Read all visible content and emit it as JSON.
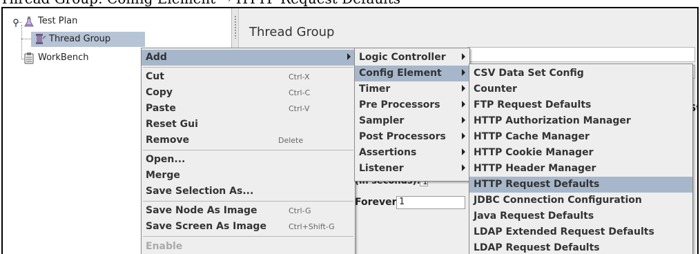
{
  "caption": "Thread Group: Config Element → HTTP Request Defaults",
  "tree": {
    "nodes": [
      {
        "label": "Test Plan",
        "icon": "flask-icon"
      },
      {
        "label": "Thread Group",
        "icon": "spool-icon"
      },
      {
        "label": "WorkBench",
        "icon": "clipboard-icon"
      }
    ]
  },
  "panel": {
    "title": "Thread Group",
    "loop_forever_label": "Forever",
    "loop_count_value": "1",
    "ramp_label_partial": "(in seconds):",
    "ramp_value": "1",
    "side_fragment": "St"
  },
  "context_menu": {
    "items": [
      {
        "label": "Add",
        "shortcut": "",
        "submenu": true,
        "selected": true
      },
      {
        "label": "Cut",
        "shortcut": "Ctrl-X"
      },
      {
        "label": "Copy",
        "shortcut": "Ctrl-C"
      },
      {
        "label": "Paste",
        "shortcut": "Ctrl-V"
      },
      {
        "label": "Reset Gui",
        "shortcut": ""
      },
      {
        "label": "Remove",
        "shortcut": "Delete"
      },
      {
        "label": "Open...",
        "shortcut": ""
      },
      {
        "label": "Merge",
        "shortcut": ""
      },
      {
        "label": "Save Selection As...",
        "shortcut": ""
      },
      {
        "label": "Save Node As Image",
        "shortcut": "Ctrl-G"
      },
      {
        "label": "Save Screen As Image",
        "shortcut": "Ctrl+Shift-G"
      },
      {
        "label": "Enable",
        "shortcut": "",
        "disabled": true
      }
    ]
  },
  "add_submenu": {
    "items": [
      {
        "label": "Logic Controller"
      },
      {
        "label": "Config Element",
        "selected": true
      },
      {
        "label": "Timer"
      },
      {
        "label": "Pre Processors"
      },
      {
        "label": "Sampler"
      },
      {
        "label": "Post Processors"
      },
      {
        "label": "Assertions"
      },
      {
        "label": "Listener"
      }
    ]
  },
  "config_submenu": {
    "items": [
      {
        "label": "CSV Data Set Config"
      },
      {
        "label": "Counter"
      },
      {
        "label": "FTP Request Defaults"
      },
      {
        "label": "HTTP Authorization Manager"
      },
      {
        "label": "HTTP Cache Manager"
      },
      {
        "label": "HTTP Cookie Manager"
      },
      {
        "label": "HTTP Header Manager"
      },
      {
        "label": "HTTP Request Defaults",
        "selected": true
      },
      {
        "label": "JDBC Connection Configuration"
      },
      {
        "label": "Java Request Defaults"
      },
      {
        "label": "LDAP Extended Request Defaults"
      },
      {
        "label": "LDAP Request Defaults"
      }
    ]
  },
  "colors": {
    "selection": "#a7b7cb",
    "menu_bg": "#eeeeee",
    "panel_bg": "#eeeeee"
  }
}
